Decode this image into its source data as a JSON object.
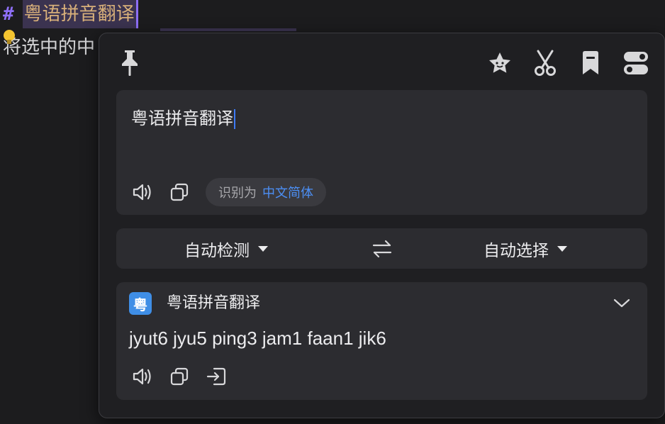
{
  "editor": {
    "heading_hash": "#",
    "heading_text": "粤语拼音翻译",
    "body_line": "将选中的中"
  },
  "popup": {
    "toolbar": {
      "pin_icon": "pin-icon",
      "right_icons": [
        "star-icon",
        "scissors-icon",
        "bookmark-icon",
        "toggle-icon"
      ]
    },
    "source": {
      "text": "粤语拼音翻译",
      "detected_prefix": "识别为",
      "detected_language": "中文简体"
    },
    "languages": {
      "from": "自动检测",
      "to": "自动选择"
    },
    "result": {
      "service_logo_char": "粤",
      "service_name": "粤语拼音翻译",
      "text": "jyut6 jyu5 ping3 jam1 faan1 jik6"
    }
  },
  "colors": {
    "accent": "#3d7af5",
    "detected_lang": "#4c8ff5",
    "heading_hash": "#8e6ff7",
    "heading_text": "#d8b07a",
    "service_logo": "#3f8ee6"
  }
}
